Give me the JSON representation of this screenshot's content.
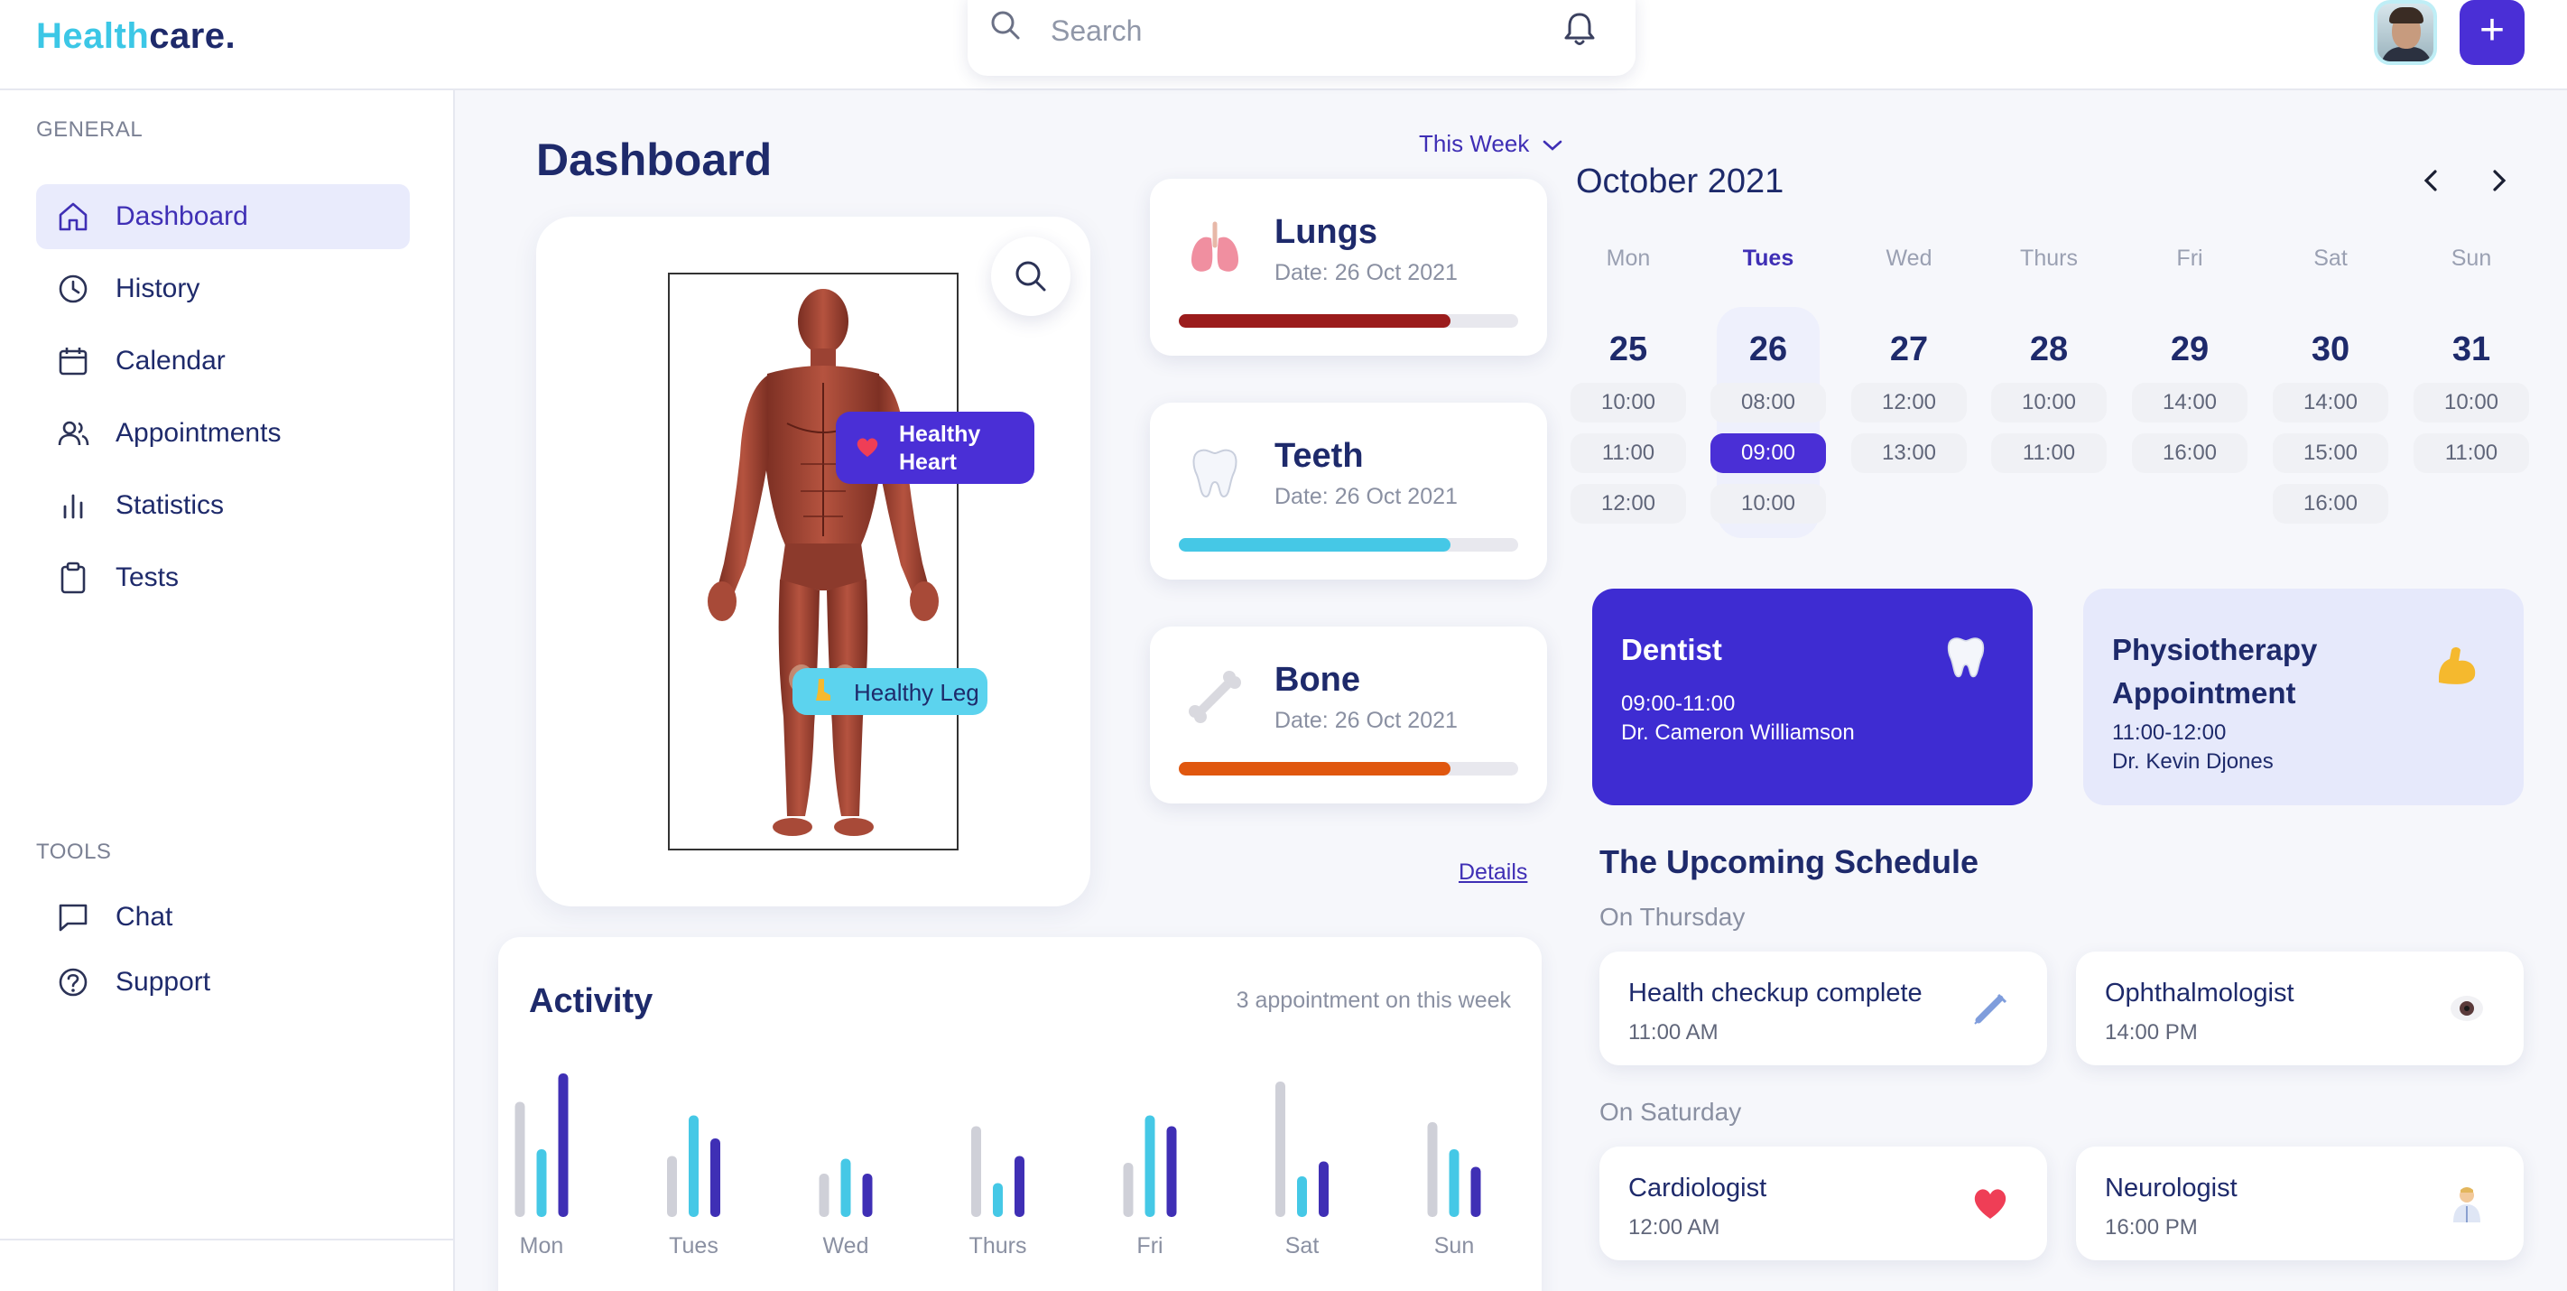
{
  "brand": {
    "part1": "Health",
    "part2": "care."
  },
  "search": {
    "placeholder": "Search"
  },
  "sidebar": {
    "general_label": "GENERAL",
    "tools_label": "TOOLS",
    "items": [
      {
        "label": "Dashboard",
        "icon": "home-icon",
        "active": true
      },
      {
        "label": "History",
        "icon": "clock-icon"
      },
      {
        "label": "Calendar",
        "icon": "calendar-icon"
      },
      {
        "label": "Appointments",
        "icon": "users-icon"
      },
      {
        "label": "Statistics",
        "icon": "bar-chart-icon"
      },
      {
        "label": "Tests",
        "icon": "clipboard-icon"
      }
    ],
    "tools": [
      {
        "label": "Chat",
        "icon": "chat-icon"
      },
      {
        "label": "Support",
        "icon": "help-circle-icon"
      }
    ]
  },
  "dashboard": {
    "title": "Dashboard",
    "week_selector": "This Week",
    "tags": {
      "heart": "Healthy Heart",
      "leg": "Healthy Leg"
    },
    "organs": [
      {
        "name": "Lungs",
        "date": "Date: 26 Oct 2021",
        "progress": 0.8,
        "color": "#9b1c1c",
        "icon": "lungs-icon"
      },
      {
        "name": "Teeth",
        "date": "Date: 26 Oct 2021",
        "progress": 0.8,
        "color": "#45c8e6",
        "icon": "tooth-icon"
      },
      {
        "name": "Bone",
        "date": "Date: 26 Oct 2021",
        "progress": 0.8,
        "color": "#e0570f",
        "icon": "bone-icon"
      }
    ],
    "details_link": "Details"
  },
  "activity": {
    "title": "Activity",
    "note": "3 appointment on this week",
    "colors": [
      "#cfd0d8",
      "#45c8e6",
      "#3f2fb5"
    ],
    "chart_data": {
      "type": "bar",
      "categories": [
        "Mon",
        "Tues",
        "Wed",
        "Thurs",
        "Fri",
        "Sat",
        "Sun"
      ],
      "series": [
        {
          "values": [
            0.85,
            0.45,
            0.32,
            0.67,
            0.4,
            1.0,
            0.7
          ]
        },
        {
          "values": [
            0.5,
            0.75,
            0.43,
            0.25,
            0.75,
            0.3,
            0.5
          ]
        },
        {
          "values": [
            1.06,
            0.58,
            0.32,
            0.45,
            0.67,
            0.41,
            0.37
          ]
        }
      ]
    }
  },
  "calendar": {
    "title": "October 2021",
    "days": [
      {
        "name": "Mon",
        "num": "25",
        "slots": [
          "10:00",
          "11:00",
          "12:00"
        ]
      },
      {
        "name": "Tues",
        "num": "26",
        "slots": [
          "08:00",
          "09:00",
          "10:00"
        ],
        "selected": true,
        "selected_slot": 1
      },
      {
        "name": "Wed",
        "num": "27",
        "slots": [
          "12:00",
          "13:00"
        ]
      },
      {
        "name": "Thurs",
        "num": "28",
        "slots": [
          "10:00",
          "11:00"
        ]
      },
      {
        "name": "Fri",
        "num": "29",
        "slots": [
          "14:00",
          "16:00"
        ]
      },
      {
        "name": "Sat",
        "num": "30",
        "slots": [
          "14:00",
          "15:00",
          "16:00"
        ]
      },
      {
        "name": "Sun",
        "num": "31",
        "slots": [
          "10:00",
          "11:00"
        ]
      }
    ]
  },
  "appointments": [
    {
      "title": "Dentist",
      "time": "09:00-11:00",
      "doctor": "Dr. Cameron Williamson",
      "icon": "tooth-icon"
    },
    {
      "title": "Physiotherapy Appointment",
      "time": "11:00-12:00",
      "doctor": "Dr. Kevin Djones",
      "icon": "flexed-bicep-icon"
    }
  ],
  "schedule": {
    "title": "The Upcoming Schedule",
    "groups": [
      {
        "day": "On Thursday",
        "items": [
          {
            "name": "Health checkup complete",
            "time": "11:00 AM",
            "icon": "syringe-icon"
          },
          {
            "name": "Ophthalmologist",
            "time": "14:00 PM",
            "icon": "eye-icon"
          }
        ]
      },
      {
        "day": "On Saturday",
        "items": [
          {
            "name": "Cardiologist",
            "time": "12:00 AM",
            "icon": "heart-icon"
          },
          {
            "name": "Neurologist",
            "time": "16:00 PM",
            "icon": "doctor-icon"
          }
        ]
      }
    ]
  }
}
